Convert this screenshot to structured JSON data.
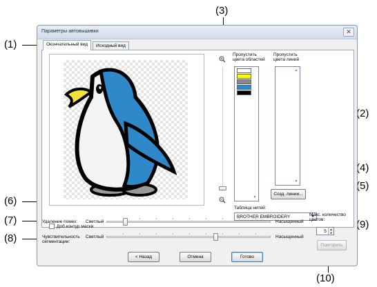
{
  "dialog": {
    "title": "Параметры автовышивки",
    "close_glyph": "✕"
  },
  "tabs": [
    {
      "label": "Окончательный вид",
      "active": true
    },
    {
      "label": "Исходный вид",
      "active": false
    }
  ],
  "skip_area_colors_label": "Пропустить\nцвета областей",
  "skip_line_colors_label": "Пропустить\nцвета линий",
  "area_color_swatches": [
    "#ffffff",
    "#ffff00",
    "#888888",
    "#2f88c7",
    "#000000"
  ],
  "create_lines_button": "Созд. линии...",
  "thread_table": {
    "label": "Таблица нитей:",
    "selected": "BROTHER EMBROIDERY"
  },
  "mask_outline_checkbox": {
    "label": "Доб.контур маски",
    "checked": false
  },
  "noise_removal": {
    "label": "Удаление помех:",
    "min_label": "Светлый",
    "max_label": "Насыщенный",
    "level": 0.05
  },
  "segmentation": {
    "label": "Чувствительность\nсегментации:",
    "min_label": "Светлый",
    "max_label": "Насыщенный",
    "level": 0.5
  },
  "max_colors": {
    "label": "Макс. количество\nцветов:",
    "value": "5"
  },
  "repeat_button": "Повторить",
  "buttons": {
    "back": "< Назад",
    "cancel": "Отмена",
    "finish": "Готово"
  },
  "callouts": [
    "(1)",
    "(2)",
    "(3)",
    "(4)",
    "(5)",
    "(6)",
    "(7)",
    "(8)",
    "(9)",
    "(10)"
  ],
  "icons": {
    "zoom_in": "zoom-in-icon",
    "zoom_out": "zoom-out-icon"
  },
  "colors": {
    "penguin_blue": "#2f88c7",
    "penguin_beak": "#f2e23a",
    "penguin_feet": "#9a9a9a",
    "default_button_accent": "#3c7fb1"
  }
}
